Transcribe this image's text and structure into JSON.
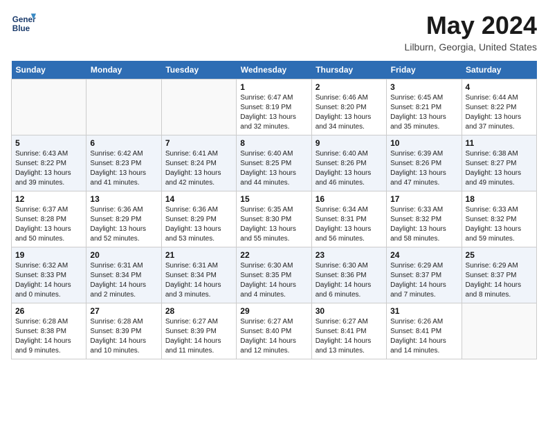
{
  "header": {
    "logo_line1": "General",
    "logo_line2": "Blue",
    "title": "May 2024",
    "location": "Lilburn, Georgia, United States"
  },
  "weekdays": [
    "Sunday",
    "Monday",
    "Tuesday",
    "Wednesday",
    "Thursday",
    "Friday",
    "Saturday"
  ],
  "weeks": [
    [
      {
        "day": "",
        "info": ""
      },
      {
        "day": "",
        "info": ""
      },
      {
        "day": "",
        "info": ""
      },
      {
        "day": "1",
        "info": "Sunrise: 6:47 AM\nSunset: 8:19 PM\nDaylight: 13 hours\nand 32 minutes."
      },
      {
        "day": "2",
        "info": "Sunrise: 6:46 AM\nSunset: 8:20 PM\nDaylight: 13 hours\nand 34 minutes."
      },
      {
        "day": "3",
        "info": "Sunrise: 6:45 AM\nSunset: 8:21 PM\nDaylight: 13 hours\nand 35 minutes."
      },
      {
        "day": "4",
        "info": "Sunrise: 6:44 AM\nSunset: 8:22 PM\nDaylight: 13 hours\nand 37 minutes."
      }
    ],
    [
      {
        "day": "5",
        "info": "Sunrise: 6:43 AM\nSunset: 8:22 PM\nDaylight: 13 hours\nand 39 minutes."
      },
      {
        "day": "6",
        "info": "Sunrise: 6:42 AM\nSunset: 8:23 PM\nDaylight: 13 hours\nand 41 minutes."
      },
      {
        "day": "7",
        "info": "Sunrise: 6:41 AM\nSunset: 8:24 PM\nDaylight: 13 hours\nand 42 minutes."
      },
      {
        "day": "8",
        "info": "Sunrise: 6:40 AM\nSunset: 8:25 PM\nDaylight: 13 hours\nand 44 minutes."
      },
      {
        "day": "9",
        "info": "Sunrise: 6:40 AM\nSunset: 8:26 PM\nDaylight: 13 hours\nand 46 minutes."
      },
      {
        "day": "10",
        "info": "Sunrise: 6:39 AM\nSunset: 8:26 PM\nDaylight: 13 hours\nand 47 minutes."
      },
      {
        "day": "11",
        "info": "Sunrise: 6:38 AM\nSunset: 8:27 PM\nDaylight: 13 hours\nand 49 minutes."
      }
    ],
    [
      {
        "day": "12",
        "info": "Sunrise: 6:37 AM\nSunset: 8:28 PM\nDaylight: 13 hours\nand 50 minutes."
      },
      {
        "day": "13",
        "info": "Sunrise: 6:36 AM\nSunset: 8:29 PM\nDaylight: 13 hours\nand 52 minutes."
      },
      {
        "day": "14",
        "info": "Sunrise: 6:36 AM\nSunset: 8:29 PM\nDaylight: 13 hours\nand 53 minutes."
      },
      {
        "day": "15",
        "info": "Sunrise: 6:35 AM\nSunset: 8:30 PM\nDaylight: 13 hours\nand 55 minutes."
      },
      {
        "day": "16",
        "info": "Sunrise: 6:34 AM\nSunset: 8:31 PM\nDaylight: 13 hours\nand 56 minutes."
      },
      {
        "day": "17",
        "info": "Sunrise: 6:33 AM\nSunset: 8:32 PM\nDaylight: 13 hours\nand 58 minutes."
      },
      {
        "day": "18",
        "info": "Sunrise: 6:33 AM\nSunset: 8:32 PM\nDaylight: 13 hours\nand 59 minutes."
      }
    ],
    [
      {
        "day": "19",
        "info": "Sunrise: 6:32 AM\nSunset: 8:33 PM\nDaylight: 14 hours\nand 0 minutes."
      },
      {
        "day": "20",
        "info": "Sunrise: 6:31 AM\nSunset: 8:34 PM\nDaylight: 14 hours\nand 2 minutes."
      },
      {
        "day": "21",
        "info": "Sunrise: 6:31 AM\nSunset: 8:34 PM\nDaylight: 14 hours\nand 3 minutes."
      },
      {
        "day": "22",
        "info": "Sunrise: 6:30 AM\nSunset: 8:35 PM\nDaylight: 14 hours\nand 4 minutes."
      },
      {
        "day": "23",
        "info": "Sunrise: 6:30 AM\nSunset: 8:36 PM\nDaylight: 14 hours\nand 6 minutes."
      },
      {
        "day": "24",
        "info": "Sunrise: 6:29 AM\nSunset: 8:37 PM\nDaylight: 14 hours\nand 7 minutes."
      },
      {
        "day": "25",
        "info": "Sunrise: 6:29 AM\nSunset: 8:37 PM\nDaylight: 14 hours\nand 8 minutes."
      }
    ],
    [
      {
        "day": "26",
        "info": "Sunrise: 6:28 AM\nSunset: 8:38 PM\nDaylight: 14 hours\nand 9 minutes."
      },
      {
        "day": "27",
        "info": "Sunrise: 6:28 AM\nSunset: 8:39 PM\nDaylight: 14 hours\nand 10 minutes."
      },
      {
        "day": "28",
        "info": "Sunrise: 6:27 AM\nSunset: 8:39 PM\nDaylight: 14 hours\nand 11 minutes."
      },
      {
        "day": "29",
        "info": "Sunrise: 6:27 AM\nSunset: 8:40 PM\nDaylight: 14 hours\nand 12 minutes."
      },
      {
        "day": "30",
        "info": "Sunrise: 6:27 AM\nSunset: 8:41 PM\nDaylight: 14 hours\nand 13 minutes."
      },
      {
        "day": "31",
        "info": "Sunrise: 6:26 AM\nSunset: 8:41 PM\nDaylight: 14 hours\nand 14 minutes."
      },
      {
        "day": "",
        "info": ""
      }
    ]
  ]
}
